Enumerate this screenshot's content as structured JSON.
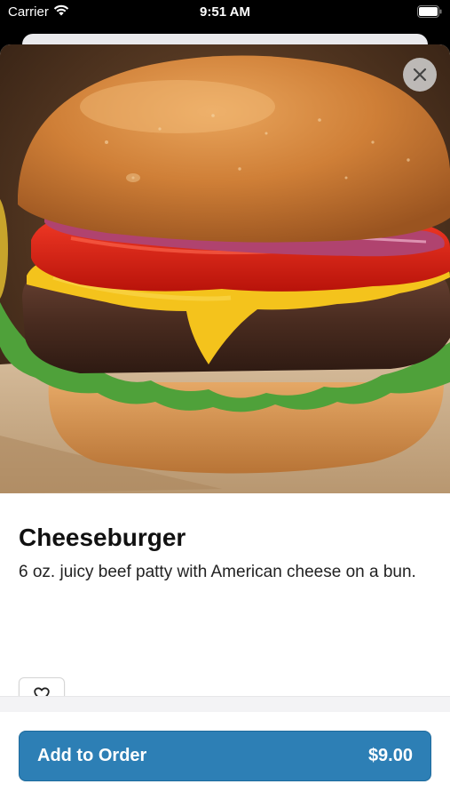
{
  "status_bar": {
    "carrier": "Carrier",
    "time": "9:51 AM"
  },
  "item": {
    "name": "Cheeseburger",
    "description": "6 oz. juicy beef patty with American cheese on a bun."
  },
  "actions": {
    "add_label": "Add to Order",
    "price": "$9.00"
  },
  "icons": {
    "close": "close-icon",
    "favorite": "heart-outline-icon",
    "wifi": "wifi-icon",
    "battery": "battery-icon"
  },
  "colors": {
    "accent": "#2d7fb5"
  }
}
